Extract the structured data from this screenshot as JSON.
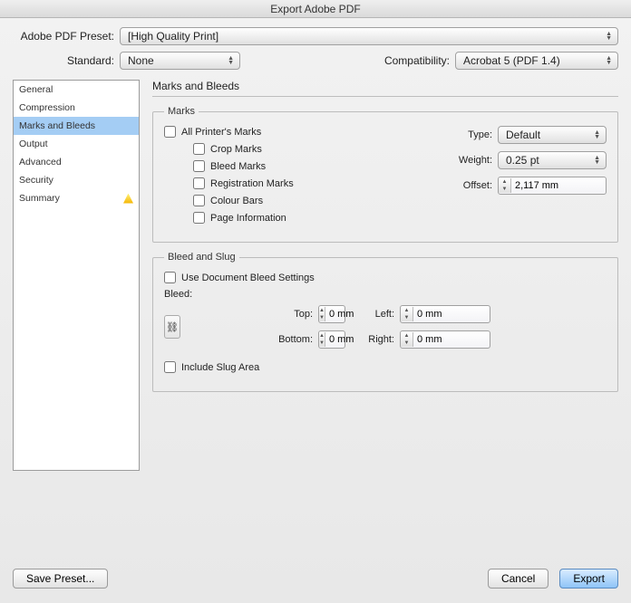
{
  "title": "Export Adobe PDF",
  "top": {
    "preset_label": "Adobe PDF Preset:",
    "preset_value": "[High Quality Print]",
    "standard_label": "Standard:",
    "standard_value": "None",
    "compat_label": "Compatibility:",
    "compat_value": "Acrobat 5 (PDF 1.4)"
  },
  "sidebar": {
    "items": [
      {
        "label": "General"
      },
      {
        "label": "Compression"
      },
      {
        "label": "Marks and Bleeds",
        "selected": true
      },
      {
        "label": "Output"
      },
      {
        "label": "Advanced"
      },
      {
        "label": "Security"
      },
      {
        "label": "Summary",
        "warn": true
      }
    ]
  },
  "section": {
    "heading": "Marks and Bleeds",
    "marks": {
      "legend": "Marks",
      "all": "All Printer's Marks",
      "crop": "Crop Marks",
      "bleed": "Bleed Marks",
      "reg": "Registration Marks",
      "colour": "Colour Bars",
      "page": "Page Information",
      "type_label": "Type:",
      "type_value": "Default",
      "weight_label": "Weight:",
      "weight_value": "0.25 pt",
      "offset_label": "Offset:",
      "offset_value": "2,117 mm"
    },
    "bleedslug": {
      "legend": "Bleed and Slug",
      "usedoc": "Use Document Bleed Settings",
      "bleed_heading": "Bleed:",
      "top_label": "Top:",
      "top_value": "0 mm",
      "bottom_label": "Bottom:",
      "bottom_value": "0 mm",
      "left_label": "Left:",
      "left_value": "0 mm",
      "right_label": "Right:",
      "right_value": "0 mm",
      "link_glyph": "⛓",
      "slug": "Include Slug Area"
    }
  },
  "footer": {
    "save": "Save Preset...",
    "cancel": "Cancel",
    "export": "Export"
  }
}
